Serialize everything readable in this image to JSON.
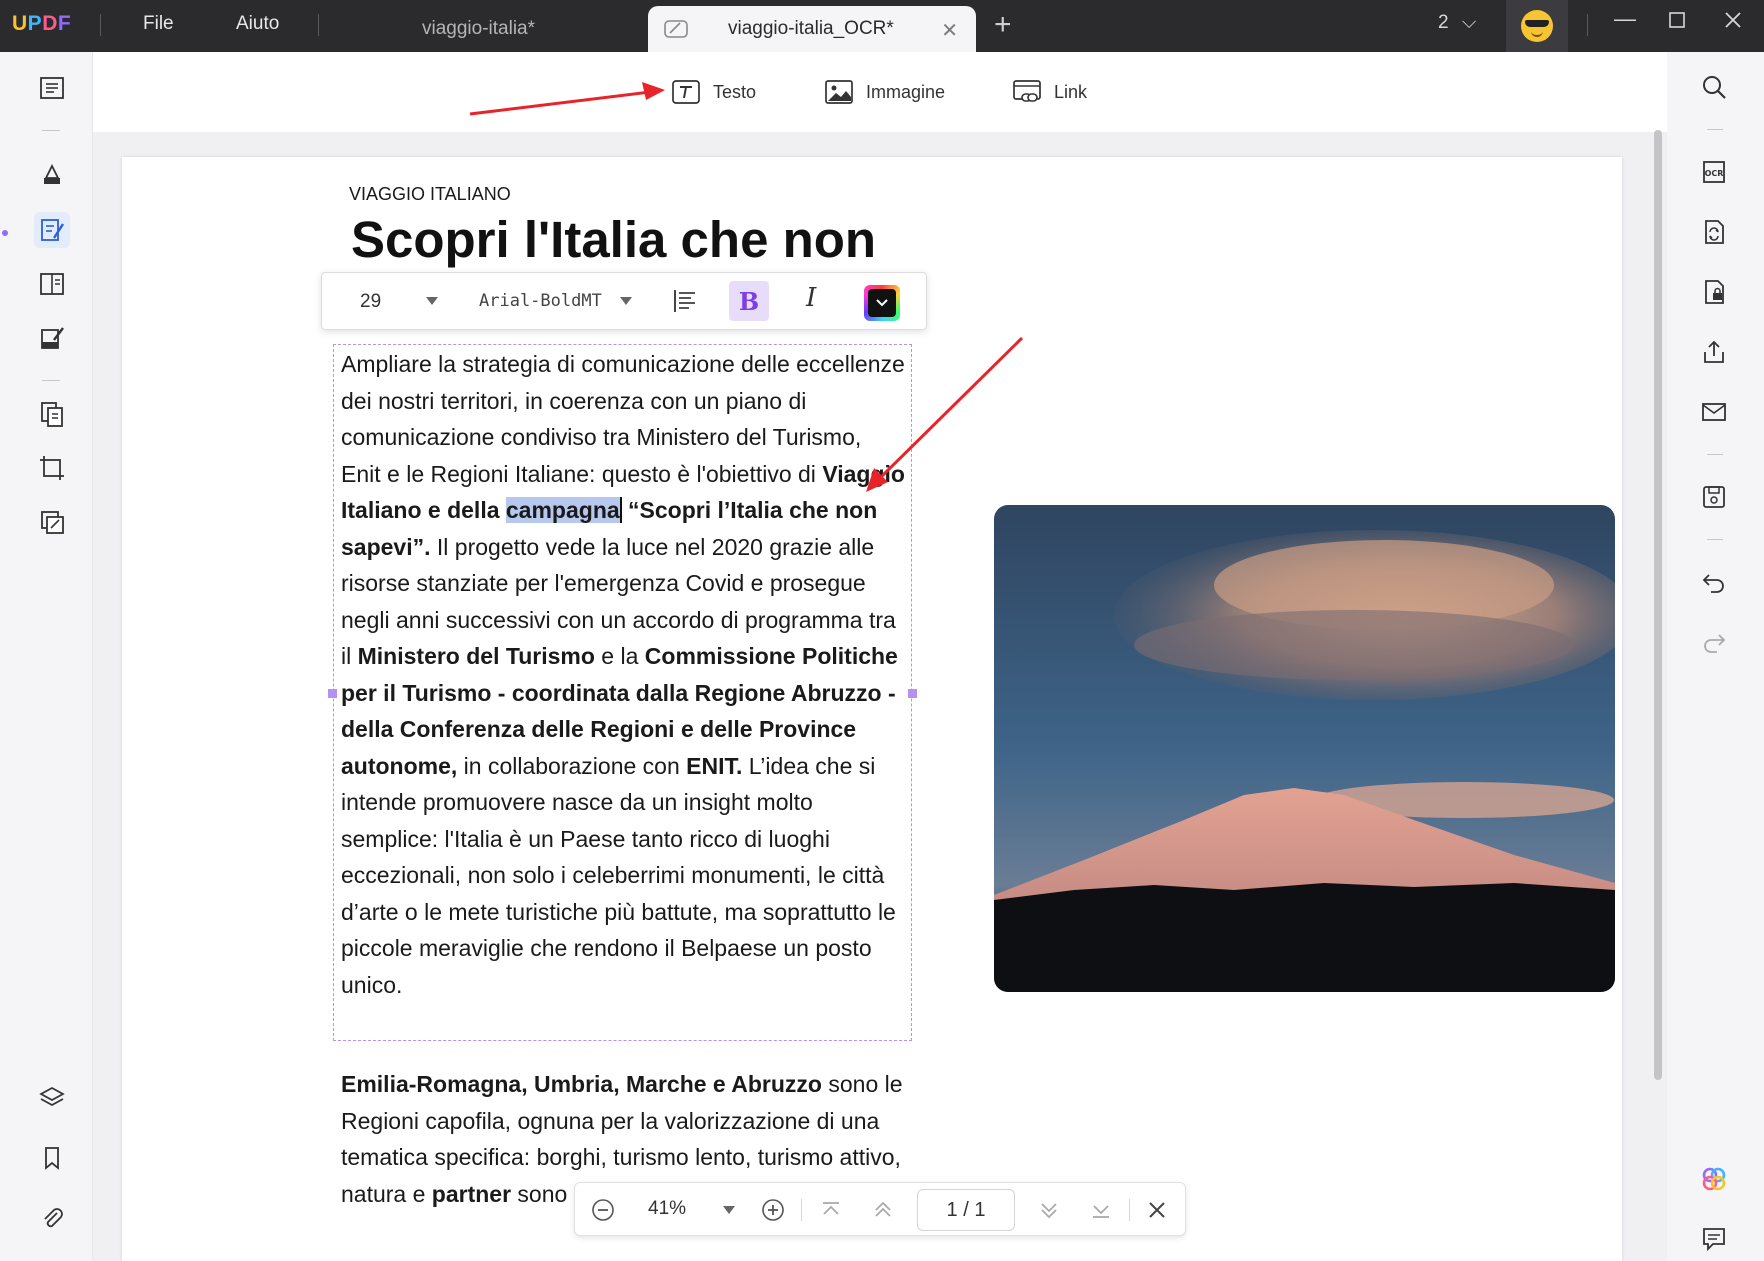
{
  "app": {
    "logo": "UPDF",
    "menu": [
      "File",
      "Aiuto"
    ],
    "tabs": [
      {
        "label": "viaggio-italia*",
        "active": false
      },
      {
        "label": "viaggio-italia_OCR*",
        "active": true
      }
    ],
    "page_count": "2"
  },
  "edit_toolbar": {
    "text_label": "Testo",
    "image_label": "Immagine",
    "link_label": "Link"
  },
  "document": {
    "kicker": "VIAGGIO ITALIANO",
    "headline": "Scopri l'Italia che non",
    "para1": [
      {
        "t": "Ampliare la strategia di comunicazione delle eccellenze dei nostri territori, in coerenza con un piano di comunicazione condiviso tra Ministero del Turismo, Enit e le Regioni Italiane: questo è l'obiettivo di "
      },
      {
        "t": "Viaggio Italiano e della ",
        "b": true
      },
      {
        "t": "campagna",
        "b": true,
        "sel": true
      },
      {
        "caret": true
      },
      {
        "t": " “Scopri l’Italia che non sapevi”.",
        "b": true
      },
      {
        "t": " Il progetto vede la luce nel 2020 grazie alle risorse stanziate per l'emergenza Covid e prosegue negli anni successivi con un accordo di programma tra il "
      },
      {
        "t": "Ministero del Turismo",
        "b": true
      },
      {
        "t": " e la "
      },
      {
        "t": "Commissione Politiche per il Turismo - coordinata dalla Regione Abruzzo - della Conferenza delle Regioni e delle Province autonome,",
        "b": true
      },
      {
        "t": " in collaborazione con "
      },
      {
        "t": "ENIT.",
        "b": true
      },
      {
        "t": " L’idea che si intende promuovere nasce da un insight molto semplice: l'Italia è un Paese tanto ricco di luoghi eccezionali, non solo i celeberrimi monumenti, le città d’arte o le mete turistiche più battute, ma soprattutto le piccole meraviglie che rendono il Belpaese un posto unico."
      }
    ],
    "para2": [
      {
        "t": "Emilia-Romagna, Umbria, Marche e Abruzzo",
        "b": true
      },
      {
        "t": " sono le Regioni capofila, ognuna per la valorizzazione di una tematica specifica: borghi, turismo lento, turismo attivo, natura e "
      },
      {
        "t": "partner",
        "b": true
      },
      {
        "t": " sono stati invece affidati alcuni temi..."
      }
    ]
  },
  "format_bar": {
    "font_size": "29",
    "font_name": "Arial-BoldMT",
    "bold_label": "B",
    "italic_label": "I",
    "text_color": "#111111"
  },
  "zoom_bar": {
    "zoom": "41%",
    "page_indicator": "1 / 1"
  },
  "colors": {
    "accent_purple": "#7b3fe4",
    "selection_border": "#b690f2",
    "annotation_arrow": "#e8232a",
    "titlebar": "#2b2b2e"
  }
}
